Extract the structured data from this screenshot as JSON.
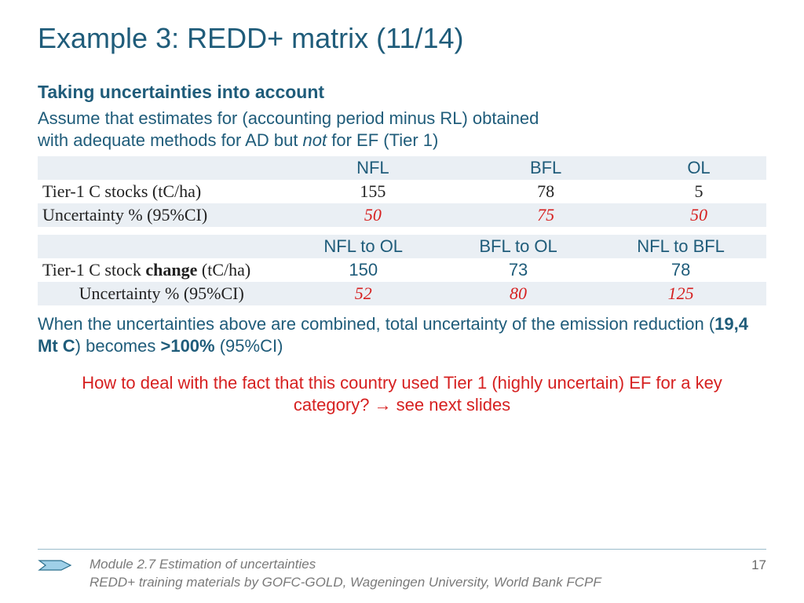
{
  "title": "Example 3: REDD+ matrix (11/14)",
  "subtitle": "Taking uncertainties into account",
  "intro_line1": "Assume that estimates for (accounting period minus RL) obtained",
  "intro_line2_a": "with adequate methods for AD but ",
  "intro_line2_em": "not",
  "intro_line2_b": " for EF (Tier 1)",
  "table1": {
    "cols": [
      "",
      "NFL",
      "BFL",
      "OL"
    ],
    "rows": [
      {
        "label": "Tier-1 C stocks (tC/ha)",
        "vals": [
          "155",
          "78",
          "5"
        ],
        "style": "num"
      },
      {
        "label": "Uncertainty % (95%CI)",
        "vals": [
          "50",
          "75",
          "50"
        ],
        "style": "red"
      }
    ]
  },
  "table2": {
    "cols": [
      "",
      "NFL to OL",
      "BFL to OL",
      "NFL to BFL"
    ],
    "rows": [
      {
        "label_a": "Tier-1 C stock ",
        "label_bold": "change",
        "label_b": " (tC/ha)",
        "vals": [
          "150",
          "73",
          "78"
        ],
        "style": "teal"
      },
      {
        "label": "Uncertainty % (95%CI)",
        "vals": [
          "52",
          "80",
          "125"
        ],
        "style": "red"
      }
    ]
  },
  "combined_a": "When the uncertainties above are combined, total uncertainty of the emission reduction (",
  "combined_bold1": "19,4 Mt C",
  "combined_b": ") becomes ",
  "combined_bold2": ">100%",
  "combined_c": " (95%CI)",
  "question": "How to deal with the fact that this country used Tier 1 (highly uncertain) EF for a key category? → see next slides",
  "footer": {
    "line1": "Module 2.7 Estimation of uncertainties",
    "line2": "REDD+ training materials by GOFC-GOLD, Wageningen University, World Bank FCPF",
    "page": "17"
  }
}
